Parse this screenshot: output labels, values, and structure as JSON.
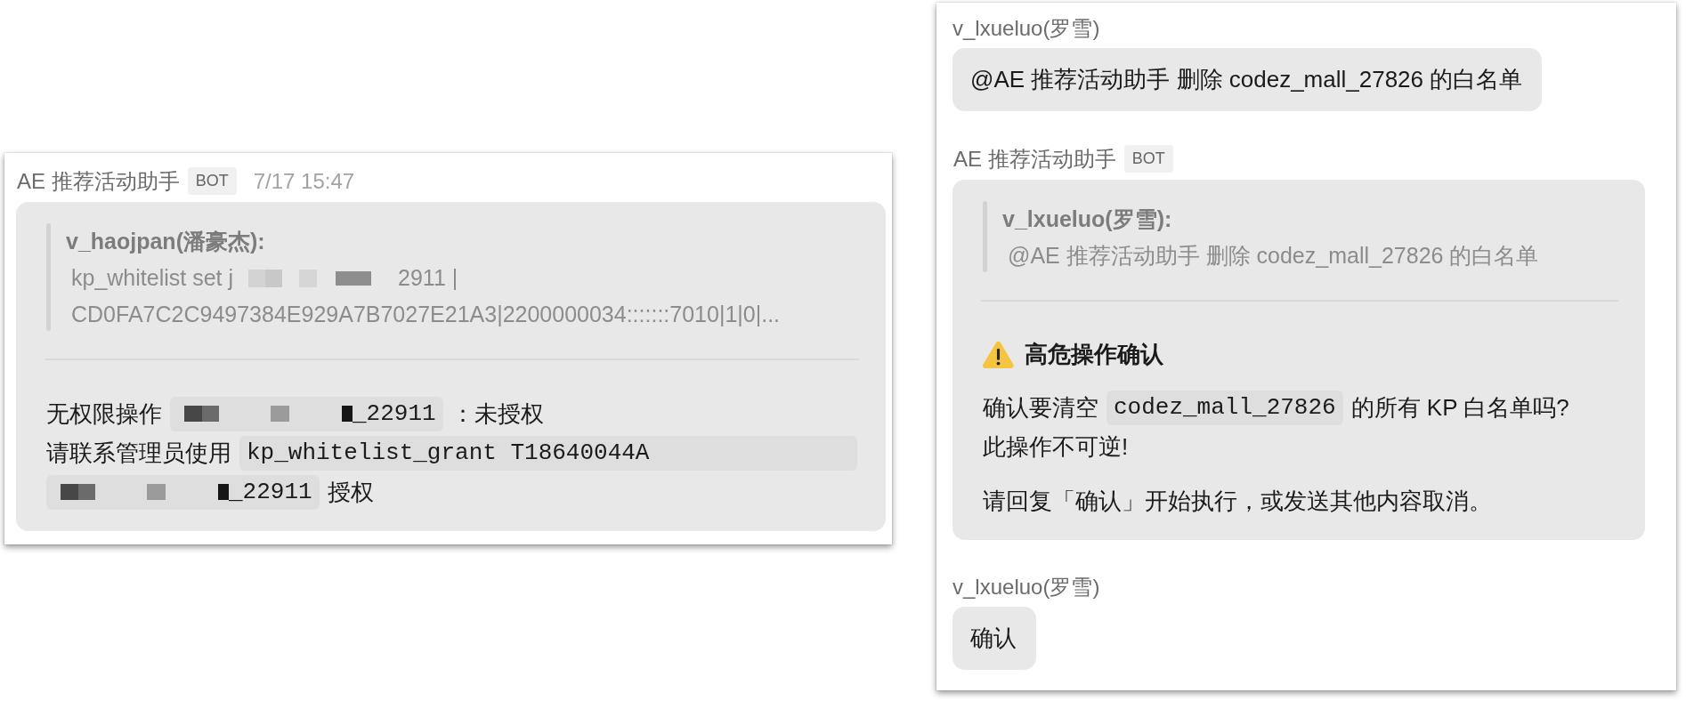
{
  "panels": [
    {
      "messages": [
        {
          "kind": "bot",
          "sender": "AE 推荐活动助手",
          "badge": "BOT",
          "time": "7/17 15:47",
          "body": [
            {
              "kind": "quote",
              "author": "v_haojpan(潘豪杰):",
              "lines": [
                [
                  {
                    "kind": "text",
                    "text": "kp_whitelist set j"
                  },
                  {
                    "kind": "redacted"
                  },
                  {
                    "kind": "text",
                    "text": "2911 |"
                  }
                ],
                [
                  {
                    "kind": "text",
                    "text": "CD0FA7C2C9497384E929A7B7027E21A3|2200000034:::::::7010|1|0|..."
                  }
                ]
              ]
            },
            {
              "kind": "divider"
            },
            {
              "kind": "paragraph",
              "lines": [
                [
                  {
                    "kind": "text",
                    "text": "无权限操作"
                  },
                  {
                    "kind": "code",
                    "parts": [
                      {
                        "kind": "redacted"
                      },
                      {
                        "kind": "text",
                        "text": "_22911"
                      }
                    ]
                  },
                  {
                    "kind": "text",
                    "text": "：未授权"
                  }
                ],
                [
                  {
                    "kind": "text",
                    "text": "请联系管理员使用"
                  },
                  {
                    "kind": "code",
                    "parts": [
                      {
                        "kind": "text",
                        "text": "kp_whitelist_grant T18640044A"
                      }
                    ]
                  }
                ],
                [
                  {
                    "kind": "code",
                    "parts": [
                      {
                        "kind": "redacted"
                      },
                      {
                        "kind": "text",
                        "text": "_22911"
                      }
                    ]
                  },
                  {
                    "kind": "text",
                    "text": "授权"
                  }
                ]
              ]
            }
          ]
        }
      ]
    },
    {
      "messages": [
        {
          "kind": "user",
          "sender": "v_lxueluo(罗雪)",
          "text": "@AE 推荐活动助手 删除 codez_mall_27826 的白名单"
        },
        {
          "kind": "bot",
          "sender": "AE 推荐活动助手",
          "badge": "BOT",
          "body": [
            {
              "kind": "quote",
              "author": "v_lxueluo(罗雪):",
              "lines": [
                [
                  {
                    "kind": "text",
                    "text": "@AE 推荐活动助手 删除 codez_mall_27826 的白名单"
                  }
                ]
              ]
            },
            {
              "kind": "divider"
            },
            {
              "kind": "alert_heading",
              "text": "高危操作确认"
            },
            {
              "kind": "paragraph",
              "lines": [
                [
                  {
                    "kind": "text",
                    "text": "确认要清空"
                  },
                  {
                    "kind": "code",
                    "parts": [
                      {
                        "kind": "text",
                        "text": "codez_mall_27826"
                      }
                    ]
                  },
                  {
                    "kind": "text",
                    "text": "的所有 KP 白名单吗?"
                  }
                ],
                [
                  {
                    "kind": "text",
                    "text": "此操作不可逆!"
                  }
                ]
              ]
            },
            {
              "kind": "paragraph",
              "lines": [
                [
                  {
                    "kind": "text",
                    "text": "请回复「确认」开始执行，或发送其他内容取消。"
                  }
                ]
              ]
            }
          ]
        },
        {
          "kind": "user",
          "sender": "v_lxueluo(罗雪)",
          "text": "确认"
        }
      ]
    }
  ]
}
